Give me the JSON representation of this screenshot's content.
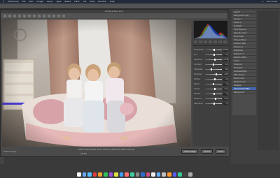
{
  "menubar": {
    "items": [
      "Photoshop",
      "File",
      "Edit",
      "Image",
      "Layer",
      "Type",
      "Select",
      "Filter",
      "3D",
      "View",
      "Window",
      "Help"
    ],
    "clock": "Sun 12:00"
  },
  "acr": {
    "title": "Camera Raw 10.0",
    "panel_sliders": [
      {
        "label": "Temperature",
        "value": "5200",
        "pos": 0.5
      },
      {
        "label": "Tint",
        "value": "+4",
        "pos": 0.52
      },
      {
        "label": "Exposure",
        "value": "+0.35",
        "pos": 0.55
      },
      {
        "label": "Contrast",
        "value": "-12",
        "pos": 0.45
      },
      {
        "label": "Highlights",
        "value": "-40",
        "pos": 0.35
      },
      {
        "label": "Shadows",
        "value": "+28",
        "pos": 0.64
      },
      {
        "label": "Whites",
        "value": "+6",
        "pos": 0.53
      },
      {
        "label": "Blacks",
        "value": "-8",
        "pos": 0.47
      },
      {
        "label": "Clarity",
        "value": "+10",
        "pos": 0.55
      },
      {
        "label": "Dehaze",
        "value": "0",
        "pos": 0.5
      },
      {
        "label": "Vibrance",
        "value": "+15",
        "pos": 0.57
      },
      {
        "label": "Saturation",
        "value": "-5",
        "pos": 0.48
      }
    ],
    "footer": {
      "save_label": "Save Image...",
      "info": "Adobe RGB (1998); 8 bit; 5760 by 3840 (22.1MP); 300 ppi",
      "zoom": "19.2%",
      "open_label": "Open Image",
      "cancel_label": "Cancel",
      "done_label": "Done"
    }
  },
  "layers": {
    "items": [
      "Layer 1",
      "Background copy",
      "Curves 1",
      "Levels 1",
      "Hue/Sat 1",
      "Color Balance",
      "Selective Color",
      "Photo Filter",
      "Channel Mixer",
      "Gradient Map",
      "Vibrance 1",
      "Brightness",
      "Exposure 1",
      "Black & White",
      "Invert",
      "Posterize",
      "Threshold",
      "Shadows/Highl.",
      "HDR Toning",
      "Match Color",
      "Replace Color",
      "Equalize",
      "Camera Raw Filter",
      "Background"
    ],
    "selected_index": 22
  },
  "dock": {
    "colors": [
      "#ffffff",
      "#6aa7ff",
      "#55c0ff",
      "#e04040",
      "#f0a030",
      "#30c060",
      "#a050e0",
      "#e0e040",
      "#3aa0ff",
      "#ff7070",
      "#40d0a0",
      "#888888",
      "#2f6fd0",
      "#d05080",
      "#eeeeee",
      "#60b0ff",
      "#c0c0c0",
      "#ff9a30",
      "#5a5aff",
      "#33cc99",
      "#444444",
      "#aaaaaa"
    ]
  }
}
